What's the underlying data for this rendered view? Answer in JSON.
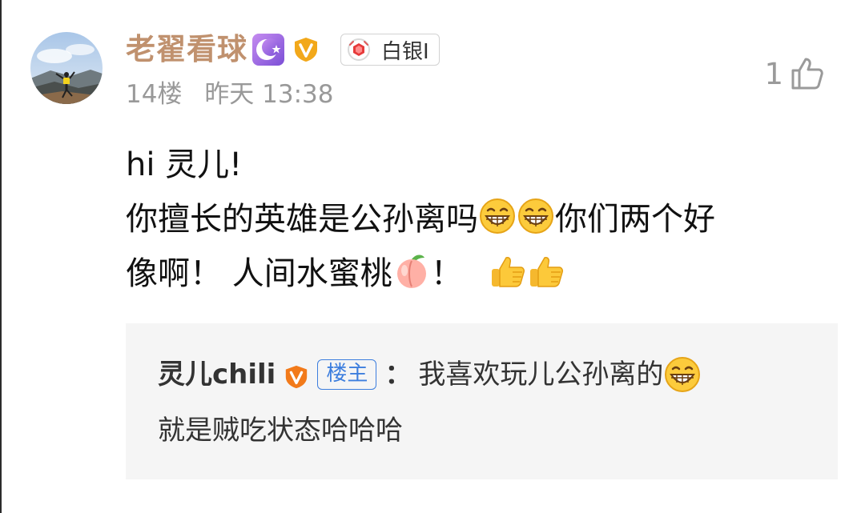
{
  "comment": {
    "username": "老翟看球",
    "level_badge": "白银I",
    "floor": "14楼",
    "time": "昨天 13:38",
    "like_count": "1",
    "content_line1": "hi 灵儿!",
    "content_line2_text": "你擅长的英雄是公孙离吗",
    "content_line2_tail": "你们两个好",
    "content_line3_text": "像啊！ 人间水蜜桃",
    "content_line3_tail": "！"
  },
  "reply": {
    "username": "灵儿chili",
    "host_tag": "楼主",
    "colon": "：",
    "text_line1": "我喜欢玩儿公孙离的",
    "text_line2": "就是贼吃状态哈哈哈"
  },
  "icons": {
    "moon_badge": "crescent-star-icon",
    "vip_badge": "v-shield-icon",
    "medal": "silver-medal-icon",
    "like": "thumbs-up-outline-icon",
    "grin": "grin-emoji",
    "peach": "peach-emoji",
    "thumbs": "thumbs-up-emoji"
  },
  "colors": {
    "username": "#c0916e",
    "meta": "#999999",
    "host_tag": "#3d7ede",
    "reply_bg": "#f5f5f5"
  }
}
